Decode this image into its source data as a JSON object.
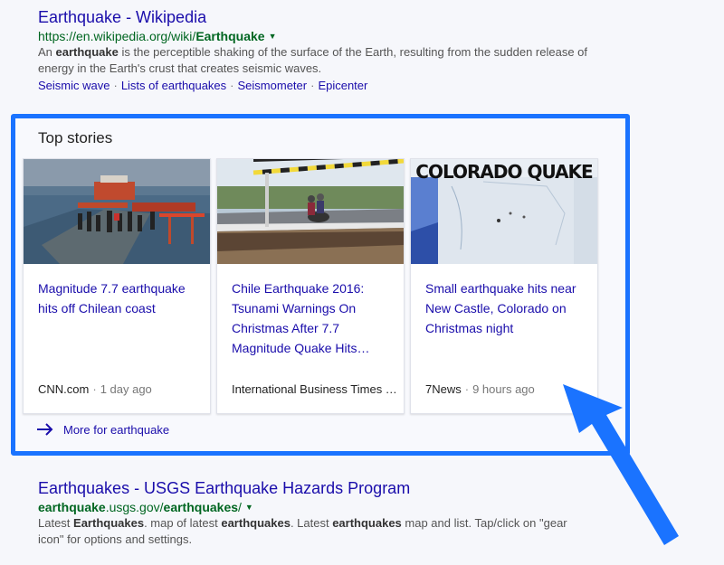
{
  "result1": {
    "title": "Earthquake - Wikipedia",
    "url_prefix": "https://en.wikipedia.org/wiki/",
    "url_bold": "Earthquake",
    "snippet_pre": "An ",
    "snippet_bold": "earthquake",
    "snippet_post": " is the perceptible shaking of the surface of the Earth, resulting from the sudden release of energy in the Earth's crust that creates seismic waves.",
    "links": [
      "Seismic wave",
      "Lists of earthquakes",
      "Seismometer",
      "Epicenter"
    ]
  },
  "top_stories": {
    "title": "Top stories",
    "more_label": "More for earthquake",
    "cards": [
      {
        "headline": "Magnitude 7.7 earthquake hits off Chilean coast",
        "source": "CNN.com",
        "time": "1 day ago"
      },
      {
        "headline": "Chile Earthquake 2016: Tsunami Warnings On Christmas After 7.7 Magnitude Quake Hits…",
        "source": "International Business Times …",
        "time": ""
      },
      {
        "headline": "Small earthquake hits near New Castle, Colorado on Christmas night",
        "source": "7News",
        "time": "9 hours ago",
        "thumb_text": "COLORADO QUAKE"
      }
    ]
  },
  "result2": {
    "title": "Earthquakes - USGS Earthquake Hazards Program",
    "url_b1": "earthquake",
    "url_mid": ".usgs.gov/",
    "url_b2": "earthquakes",
    "url_end": "/",
    "snippet": [
      {
        "t": "Latest ",
        "b": false
      },
      {
        "t": "Earthquakes",
        "b": true
      },
      {
        "t": ". map of latest ",
        "b": false
      },
      {
        "t": "earthquakes",
        "b": true
      },
      {
        "t": ". Latest ",
        "b": false
      },
      {
        "t": "earthquakes",
        "b": true
      },
      {
        "t": " map and list. Tap/click on \"gear icon\" for options and settings.",
        "b": false
      }
    ]
  },
  "colors": {
    "link": "#1a0dab",
    "url": "#006621",
    "highlight": "#1a73ff"
  }
}
